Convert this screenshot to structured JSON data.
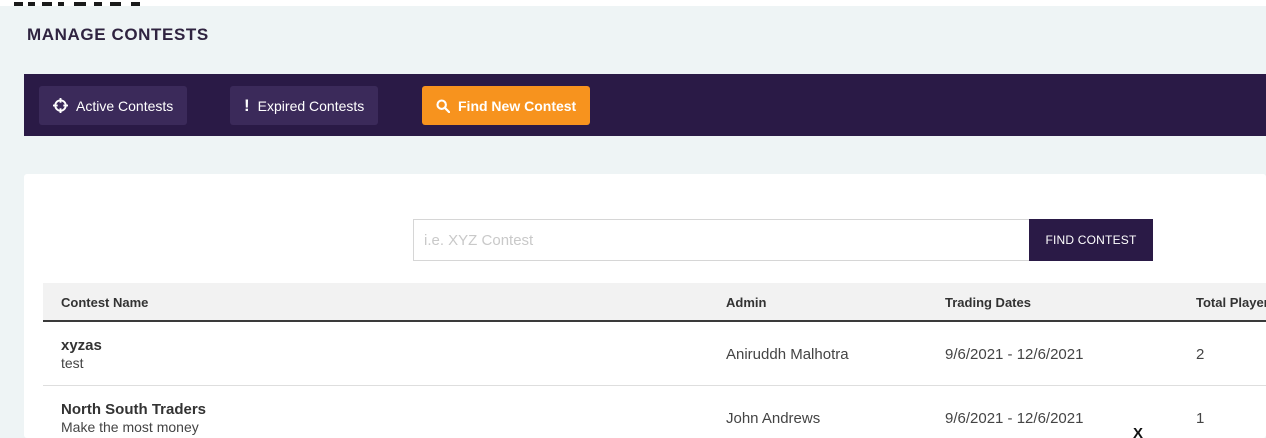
{
  "page": {
    "title": "MANAGE CONTESTS"
  },
  "nav": {
    "buttons": [
      {
        "label": "Active Contests",
        "icon": "crosshair-icon"
      },
      {
        "label": "Expired Contests",
        "icon": "exclamation-icon"
      },
      {
        "label": "Find New Contest",
        "icon": "search-icon"
      }
    ]
  },
  "search": {
    "placeholder": "i.e. XYZ Contest",
    "value": "",
    "button_label": "FIND CONTEST"
  },
  "table": {
    "columns": [
      "Contest Name",
      "Admin",
      "Trading Dates",
      "Total Player"
    ],
    "rows": [
      {
        "name": "xyzas",
        "description": "test",
        "admin": "Aniruddh Malhotra",
        "dates": "9/6/2021 - 12/6/2021",
        "players": "2"
      },
      {
        "name": "North South Traders",
        "description": "Make the most money",
        "admin": "John Andrews",
        "dates": "9/6/2021 - 12/6/2021",
        "players": "1"
      }
    ]
  },
  "overlay": {
    "stray_mark": "X"
  },
  "colors": {
    "nav_background": "#2a1a46",
    "nav_button": "#3b2a5a",
    "accent": "#f7931e",
    "page_background": "#eef4f5"
  }
}
